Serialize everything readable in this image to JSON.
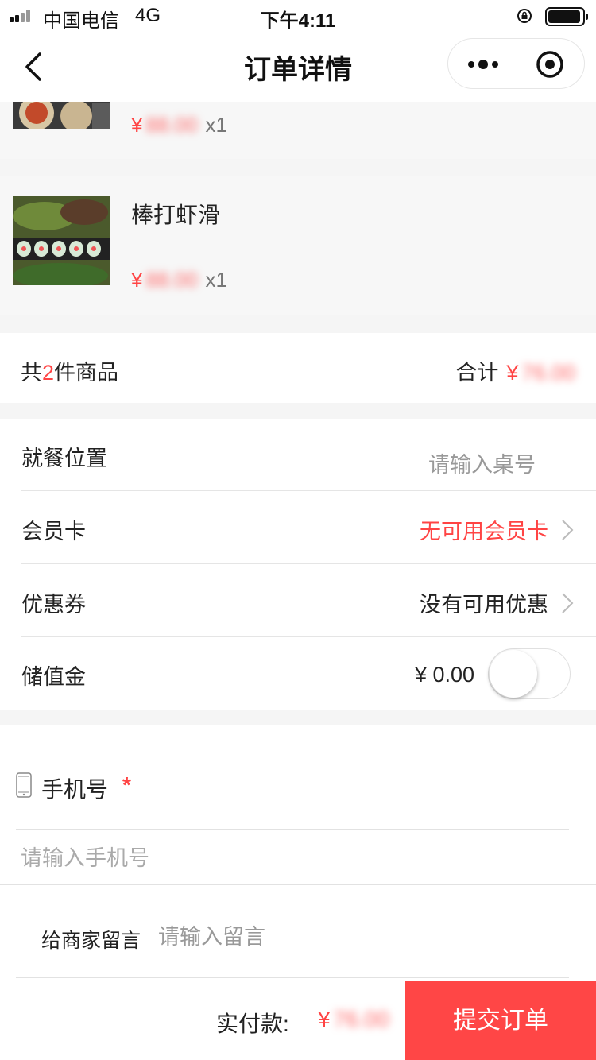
{
  "status_bar": {
    "carrier": "中国电信",
    "network": "4G",
    "time": "下午4:11"
  },
  "nav": {
    "title": "订单详情"
  },
  "products": [
    {
      "name": "",
      "price_symbol": "¥",
      "price": "88.00",
      "qty": "x1"
    },
    {
      "name": "棒打虾滑",
      "price_symbol": "¥",
      "price": "88.00",
      "qty": "x1"
    }
  ],
  "summary": {
    "prefix": "共",
    "count": "2",
    "suffix": "件商品",
    "total_label": "合计",
    "total_symbol": "¥",
    "total_value": "76.00"
  },
  "options": {
    "dining_label": "就餐位置",
    "dining_placeholder": "请输入桌号",
    "member_label": "会员卡",
    "member_value": "无可用会员卡",
    "coupon_label": "优惠券",
    "coupon_value": "没有可用优惠",
    "stored_label": "储值金",
    "stored_value": "¥ 0.00"
  },
  "contact": {
    "phone_label": "手机号",
    "required_mark": "*",
    "phone_placeholder": "请输入手机号",
    "message_label": "给商家留言",
    "message_placeholder": "请输入留言"
  },
  "footer": {
    "pay_label": "实付款:",
    "pay_symbol": "¥",
    "pay_value": "76.00",
    "submit_label": "提交订单"
  },
  "colors": {
    "accent": "#ff4646",
    "price_red": "#ff4444"
  }
}
